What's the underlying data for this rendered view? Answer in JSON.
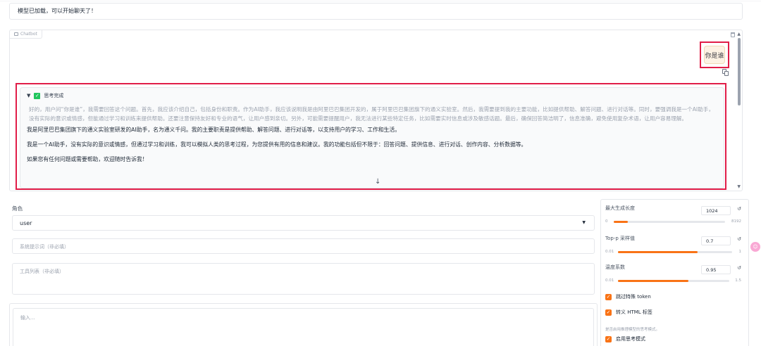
{
  "status": {
    "text": "模型已加载，可以开始聊天了！"
  },
  "chatbot": {
    "label": "Chatbot",
    "user_message": "你是谁",
    "think": {
      "header": "思考完成",
      "text": "好的，用户问“你是谁”，我需要回答这个问题。首先，我应该介绍自己，包括身份和职责。作为AI助手，我应该说明我是由阿里巴巴集团开发的，属于阿里巴巴集团旗下的通义实验室。然后，我需要提到我的主要功能，比如提供帮助、解答问题、进行对话等。同时，要强调我是一个AI助手，没有实际的意识或情感，但能通过学习和训练来提供帮助。还要注意保持友好和专业的语气，让用户感到亲切。另外，可能需要提醒用户，我无法进行某些特定任务，比如需要实时信息或涉及敏感话题。最后，确保回答简洁明了，信息准确，避免使用复杂术语，让用户容易理解。"
    },
    "answer_paragraphs": [
      "我是阿里巴巴集团旗下的通义实验室研发的AI助手，名为通义千问。我的主要职责是提供帮助、解答问题、进行对话等，以支持用户的学习、工作和生活。",
      "我是一个AI助手，没有实际的意识或情感，但通过学习和训练，我可以模拟人类的思考过程，为您提供有用的信息和建议。我的功能包括但不限于：回答问题、提供信息、进行对话、创作内容、分析数据等。",
      "如果您有任何问题或需要帮助，欢迎随时告诉我！"
    ]
  },
  "form": {
    "role_label": "角色",
    "role_value": "user",
    "system_prompt_placeholder": "系统提示词（非必填）",
    "tools_placeholder": "工具列表（非必填）",
    "input_placeholder": "输入..."
  },
  "params": {
    "max_len": {
      "label": "最大生成长度",
      "value": "1024",
      "min": "0",
      "max": "8192",
      "fraction": 0.125
    },
    "top_p": {
      "label": "Top-p 采样值",
      "value": "0.7",
      "min": "0.01",
      "max": "1",
      "fraction": 0.697
    },
    "temperature": {
      "label": "温度系数",
      "value": "0.95",
      "min": "0.01",
      "max": "1.5",
      "fraction": 0.631
    },
    "skip_special": "跳过特殊 token",
    "escape_html": "转义 HTML 标签",
    "think_info": "是否启用推理模型的思考模式。",
    "enable_think": "启用思考模式"
  },
  "colors": {
    "accent": "#f97316",
    "highlight": "#e11d48",
    "check": "#22c55e"
  }
}
